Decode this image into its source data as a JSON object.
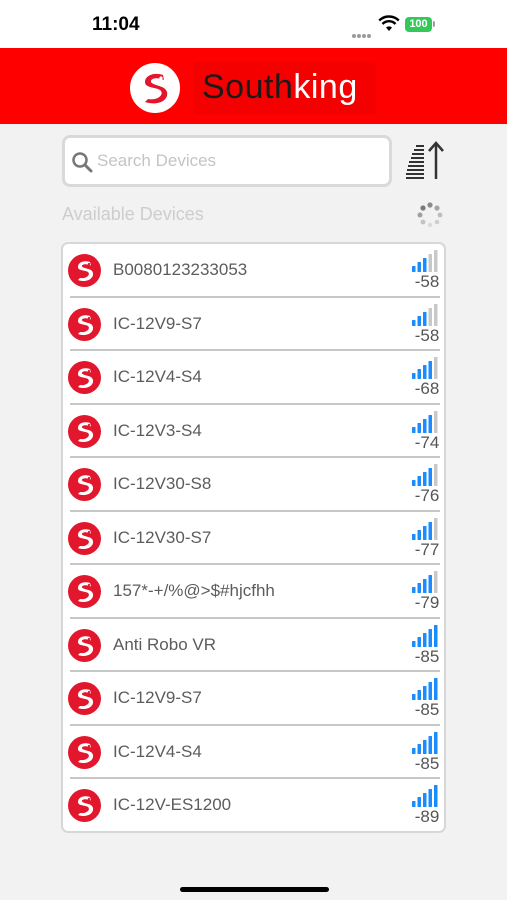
{
  "status_bar": {
    "time": "11:04",
    "battery": "100"
  },
  "header": {
    "brand_part1": "South",
    "brand_part2": "king"
  },
  "search": {
    "placeholder": "Search Devices",
    "value": ""
  },
  "section": {
    "label": "Available Devices"
  },
  "devices": [
    {
      "name": "B0080123233053",
      "rssi": "-58",
      "signal_bars": 3
    },
    {
      "name": "IC-12V9-S7",
      "rssi": "-58",
      "signal_bars": 3
    },
    {
      "name": "IC-12V4-S4",
      "rssi": "-68",
      "signal_bars": 4
    },
    {
      "name": "IC-12V3-S4",
      "rssi": "-74",
      "signal_bars": 4
    },
    {
      "name": "IC-12V30-S8",
      "rssi": "-76",
      "signal_bars": 4
    },
    {
      "name": "IC-12V30-S7",
      "rssi": "-77",
      "signal_bars": 4
    },
    {
      "name": "157*-+/%@>$#hjcfhh",
      "rssi": "-79",
      "signal_bars": 4
    },
    {
      "name": "Anti Robo VR",
      "rssi": "-85",
      "signal_bars": 5
    },
    {
      "name": "IC-12V9-S7",
      "rssi": "-85",
      "signal_bars": 5
    },
    {
      "name": "IC-12V4-S4",
      "rssi": "-85",
      "signal_bars": 5
    },
    {
      "name": "IC-12V-ES1200",
      "rssi": "-89",
      "signal_bars": 5
    }
  ],
  "colors": {
    "brand_red": "#ff0000",
    "signal_active": "#1a8cff",
    "signal_inactive": "#c8c8c8",
    "device_icon": "#e2162c"
  },
  "icons": {
    "search": "magnifier-icon",
    "sort": "sort-ascending-icon",
    "scanning": "spinner-icon",
    "device": "dragon-logo-icon",
    "signal": "signal-strength-icon"
  }
}
